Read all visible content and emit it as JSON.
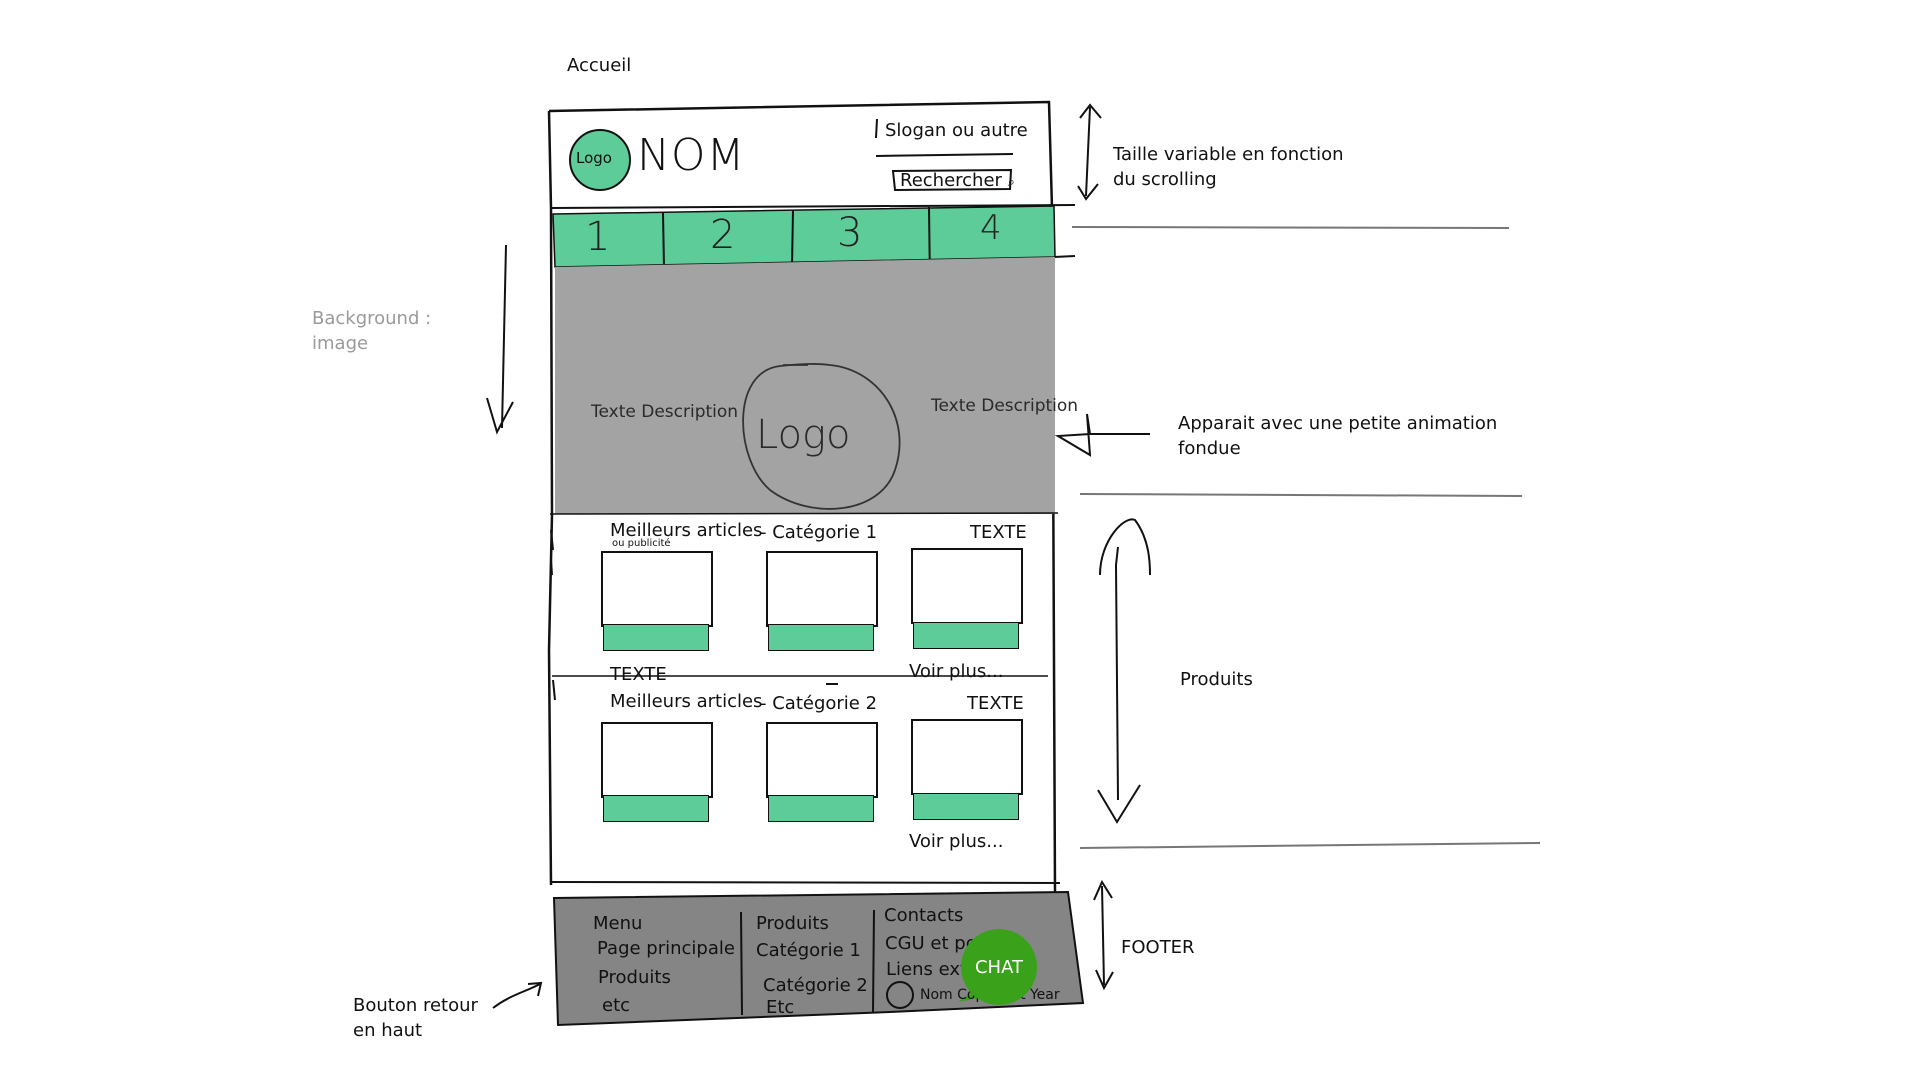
{
  "page_title": "Accueil",
  "header": {
    "logo_label": "Logo",
    "name": "NOM",
    "slogan": "Slogan ou autre",
    "search_label": "Rechercher"
  },
  "nav": {
    "items": [
      "1",
      "2",
      "3",
      "4"
    ]
  },
  "hero": {
    "left_text": "Texte\nDescription",
    "logo_label": "Logo",
    "right_text": "Texte\nDescription"
  },
  "products": {
    "section1": {
      "title": "Meilleurs articles",
      "subtitle": "ou publicité",
      "category": "- Catégorie 1",
      "right_label": "TEXTE",
      "bottom_left": "TEXTE",
      "more_link": "Voir plus..."
    },
    "section2": {
      "title": "Meilleurs articles",
      "category": "- Catégorie 2",
      "right_label": "TEXTE",
      "more_link": "Voir plus..."
    }
  },
  "footer": {
    "col1": [
      "Menu",
      "Page principale",
      "Produits",
      "etc"
    ],
    "col2": [
      "Produits",
      "Catégorie 1",
      "Catégorie 2",
      "Etc"
    ],
    "col3": [
      "Contacts",
      "CGU et po",
      "Liens exte"
    ],
    "copyright": "Nom  Copyright Year",
    "chat": "CHAT"
  },
  "annotations": {
    "header_note": "Taille variable en fonction\ndu scrolling",
    "background_note": "Background :\nimage",
    "animation_note": "Apparait avec une petite animation\nfondue",
    "products_note": "Produits",
    "footer_note": "FOOTER",
    "back_to_top_note": "Bouton retour\nen haut"
  },
  "colors": {
    "accent_green": "#5ecc98",
    "hero_gray": "#a3a3a3",
    "footer_gray": "#858585",
    "chat_green": "#3aa21a",
    "annotation_gray": "#9a9a9a"
  }
}
